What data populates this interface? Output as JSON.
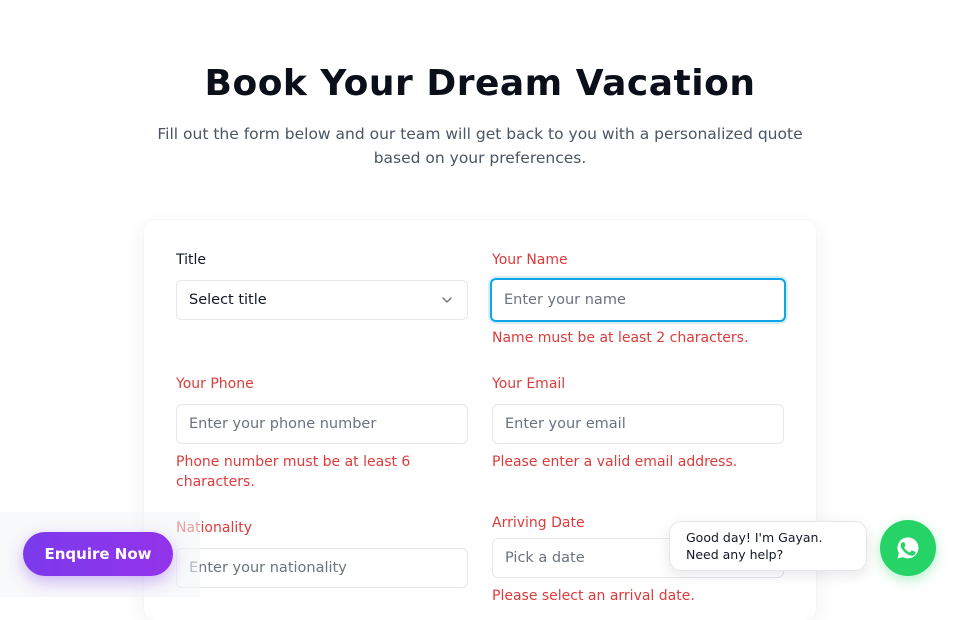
{
  "header": {
    "title": "Book Your Dream Vacation",
    "subtitle": "Fill out the form below and our team will get back to you with a personalized quote based on your preferences."
  },
  "form": {
    "title": {
      "label": "Title",
      "value": "Select title"
    },
    "name": {
      "label": "Your Name",
      "placeholder": "Enter your name",
      "error": "Name must be at least 2 characters."
    },
    "phone": {
      "label": "Your Phone",
      "placeholder": "Enter your phone number",
      "error": "Phone number must be at least 6 characters."
    },
    "email": {
      "label": "Your Email",
      "placeholder": "Enter your email",
      "error": "Please enter a valid email address."
    },
    "nationality": {
      "label": "Nationality",
      "placeholder": "Enter your nationality"
    },
    "arriving_date": {
      "label": "Arriving Date",
      "placeholder": "Pick a date",
      "error": "Please select an arrival date."
    }
  },
  "floating": {
    "enquire_label": "Enquire Now",
    "chat_line1": "Good day! I'm Gayan.",
    "chat_line2": "Need any help?",
    "chat_icon": "whatsapp-icon"
  },
  "colors": {
    "error": "#dc3b3b",
    "focus_ring": "#12a5e6",
    "enquire_gradient_start": "#7c3aed",
    "enquire_gradient_end": "#9333ea",
    "whatsapp_green": "#25d366"
  }
}
